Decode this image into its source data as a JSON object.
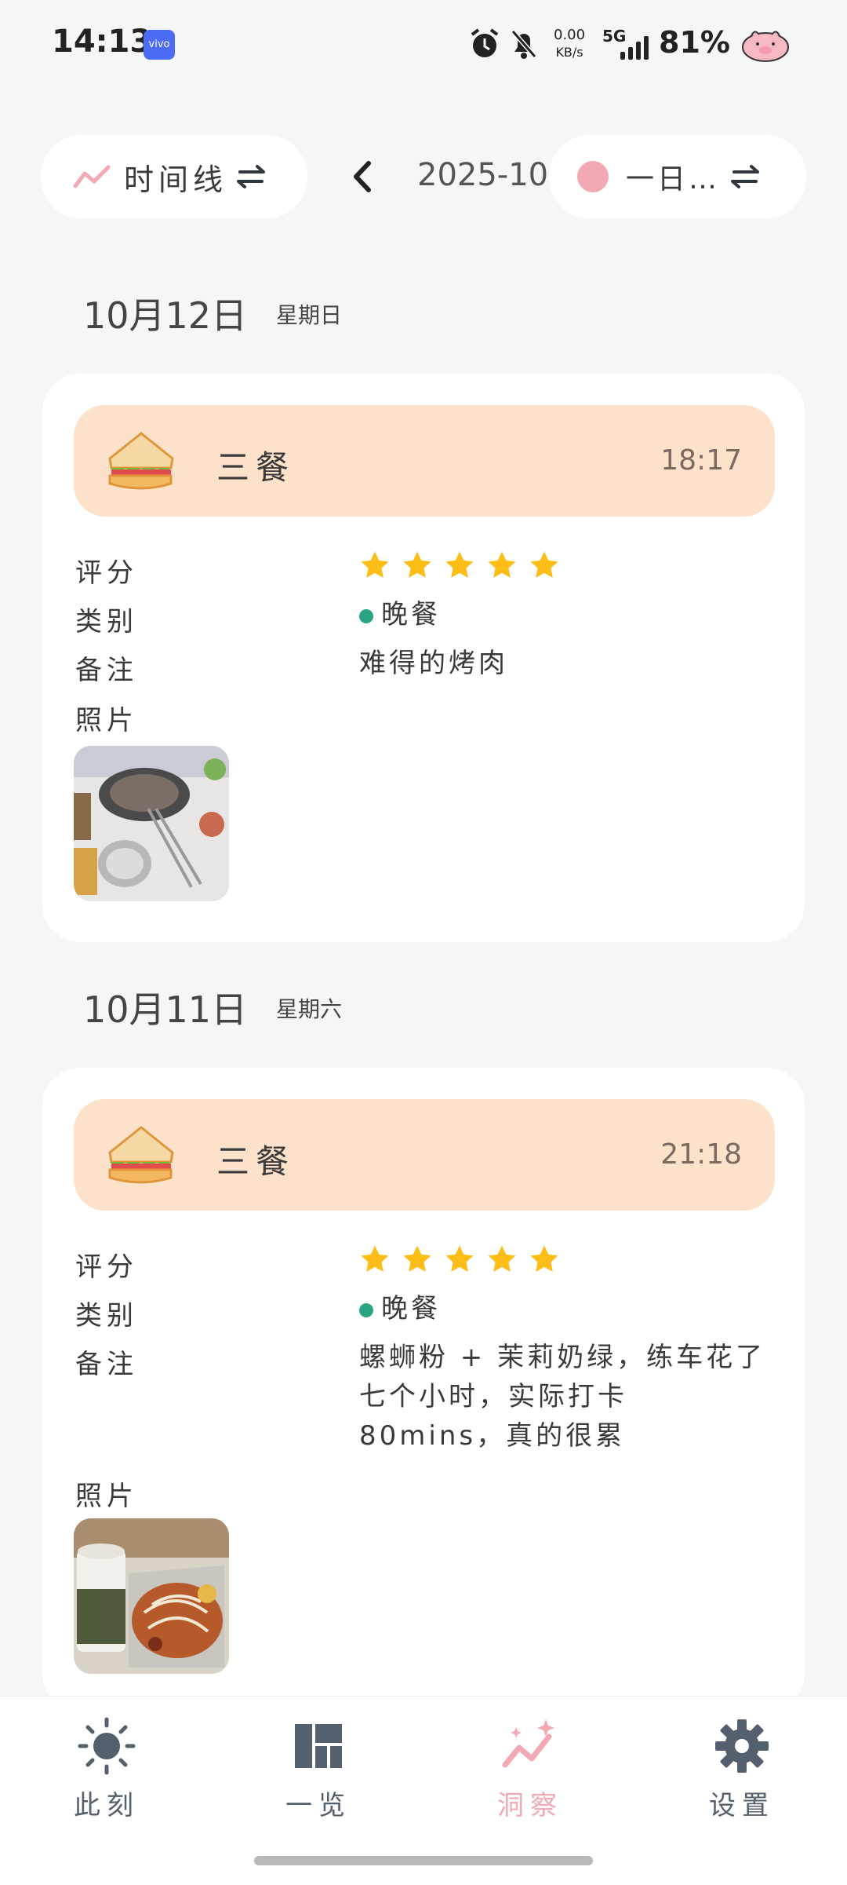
{
  "status_bar": {
    "time": "14:13",
    "carrier_badge": "vivo",
    "net_speed_value": "0.00",
    "net_speed_unit": "KB/s",
    "network": "5G",
    "battery": "81%"
  },
  "toolbar": {
    "view_mode_label": "时间线",
    "month": "2025-10",
    "filter_label": "一日…"
  },
  "days": [
    {
      "date": "10月12日",
      "weekday": "星期日",
      "entry": {
        "type_label": "三餐",
        "time": "18:17",
        "rating_label": "评分",
        "rating": 5,
        "category_label": "类别",
        "category": "晚餐",
        "note_label": "备注",
        "note": "难得的烤肉",
        "photo_label": "照片"
      }
    },
    {
      "date": "10月11日",
      "weekday": "星期六",
      "entry": {
        "type_label": "三餐",
        "time": "21:18",
        "rating_label": "评分",
        "rating": 5,
        "category_label": "类别",
        "category": "晚餐",
        "note_label": "备注",
        "note": "螺蛳粉 + 茉莉奶绿，练车花了七个小时，实际打卡80mins，真的很累",
        "photo_label": "照片"
      }
    }
  ],
  "nav": {
    "items": [
      {
        "label": "此刻",
        "icon": "sun-icon"
      },
      {
        "label": "一览",
        "icon": "grid-icon"
      },
      {
        "label": "洞察",
        "icon": "insight-icon"
      },
      {
        "label": "设置",
        "icon": "gear-icon"
      }
    ],
    "active": 2
  },
  "colors": {
    "accent": "#f2a9b3",
    "banner": "#fde2cb",
    "category_dot": "#2aa583",
    "star": "#fbbd16",
    "nav_inactive": "#55606e"
  }
}
